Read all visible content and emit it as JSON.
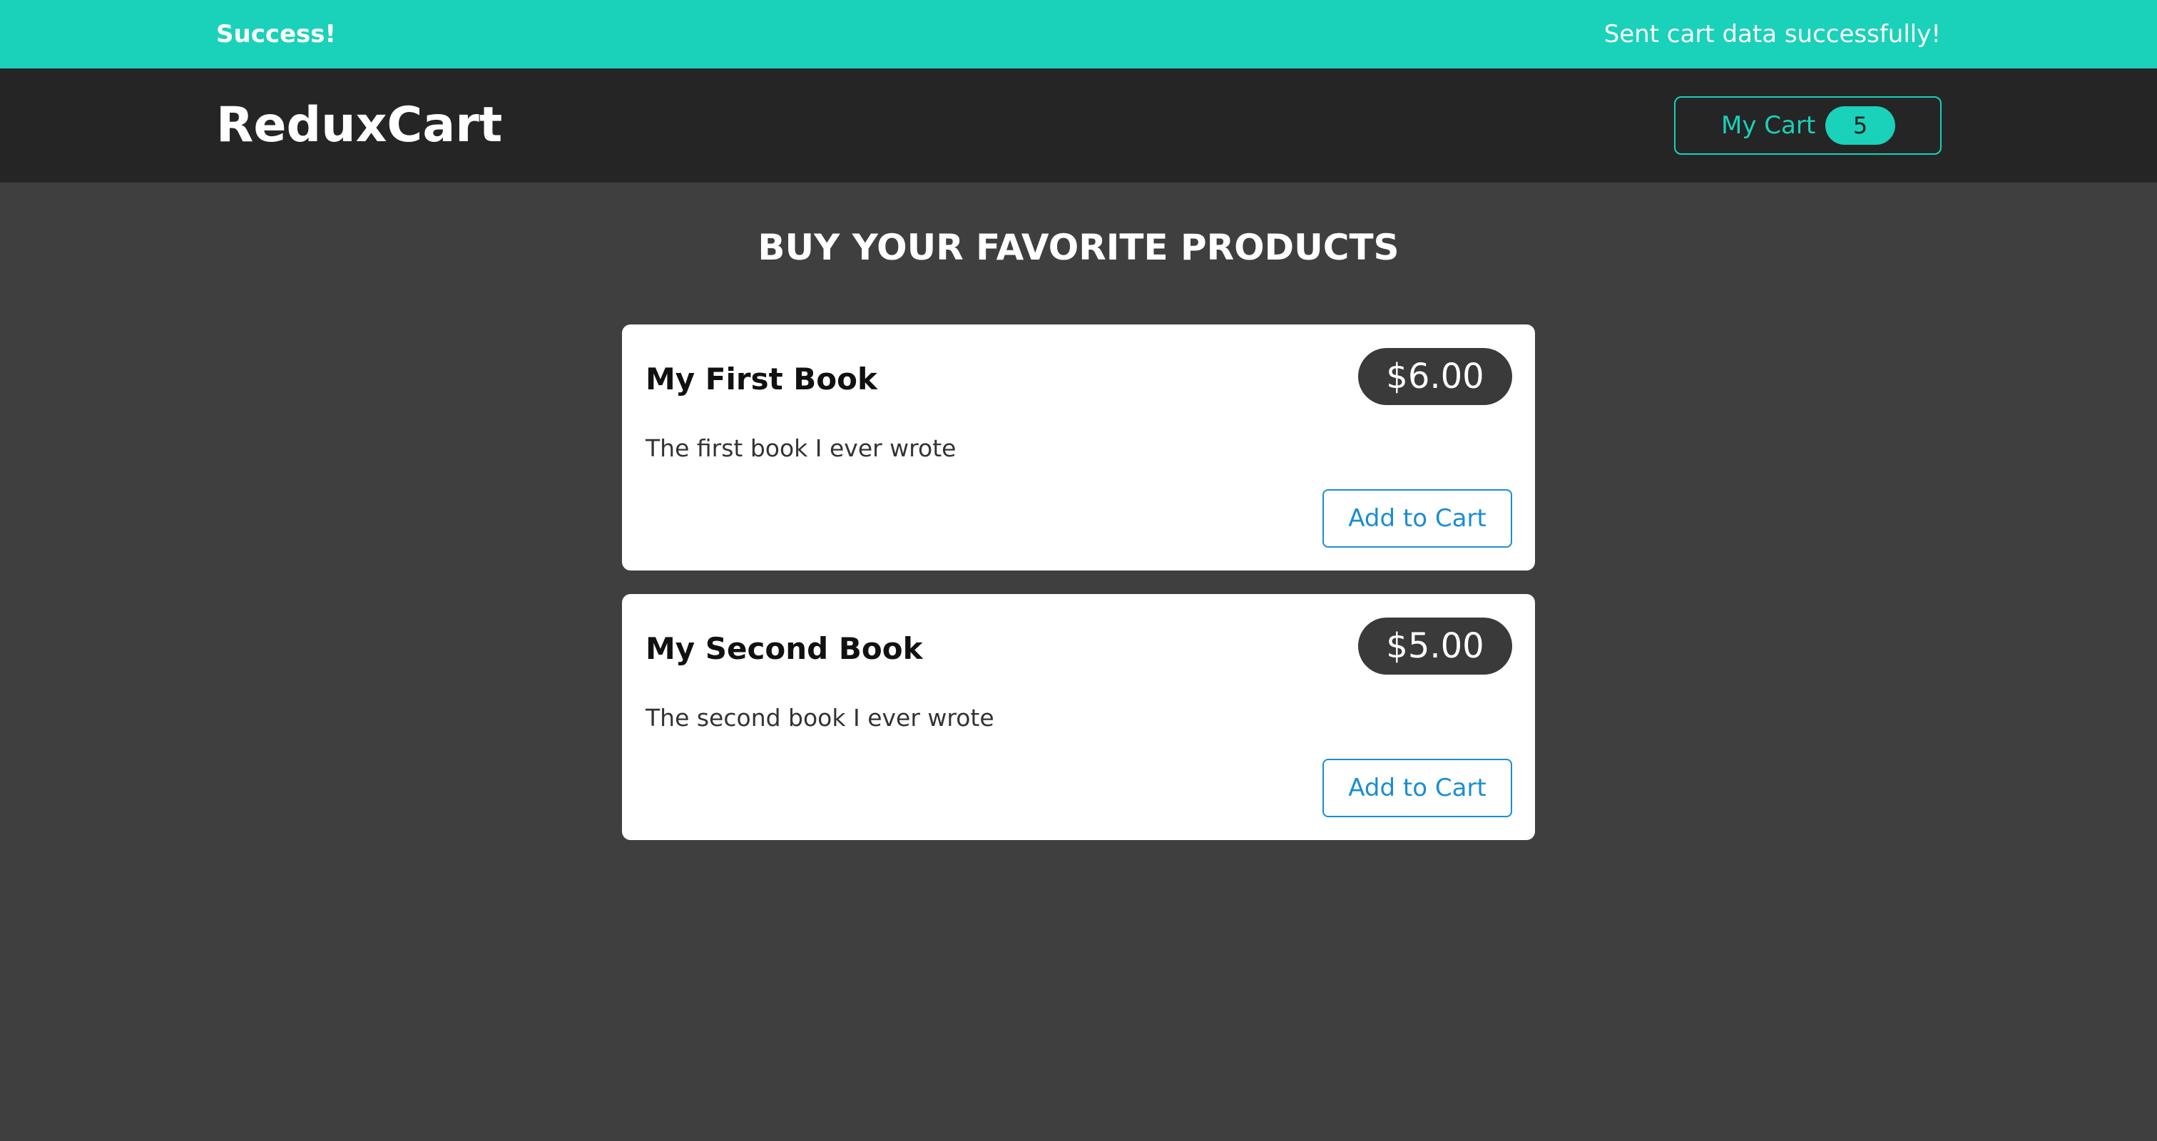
{
  "notification": {
    "title": "Success!",
    "message": "Sent cart data successfully!",
    "color": "#1ad1b9"
  },
  "header": {
    "brand": "ReduxCart",
    "cart_label": "My Cart",
    "cart_count": "5"
  },
  "main": {
    "title": "BUY YOUR FAVORITE PRODUCTS",
    "products": [
      {
        "name": "My First Book",
        "price": "$6.00",
        "description": "The first book I ever wrote",
        "button_label": "Add to Cart"
      },
      {
        "name": "My Second Book",
        "price": "$5.00",
        "description": "The second book I ever wrote",
        "button_label": "Add to Cart"
      }
    ]
  },
  "colors": {
    "accent": "#1ad1b9",
    "button_blue": "#1a8ed1",
    "background": "#3f3f3f",
    "header": "#252525"
  }
}
